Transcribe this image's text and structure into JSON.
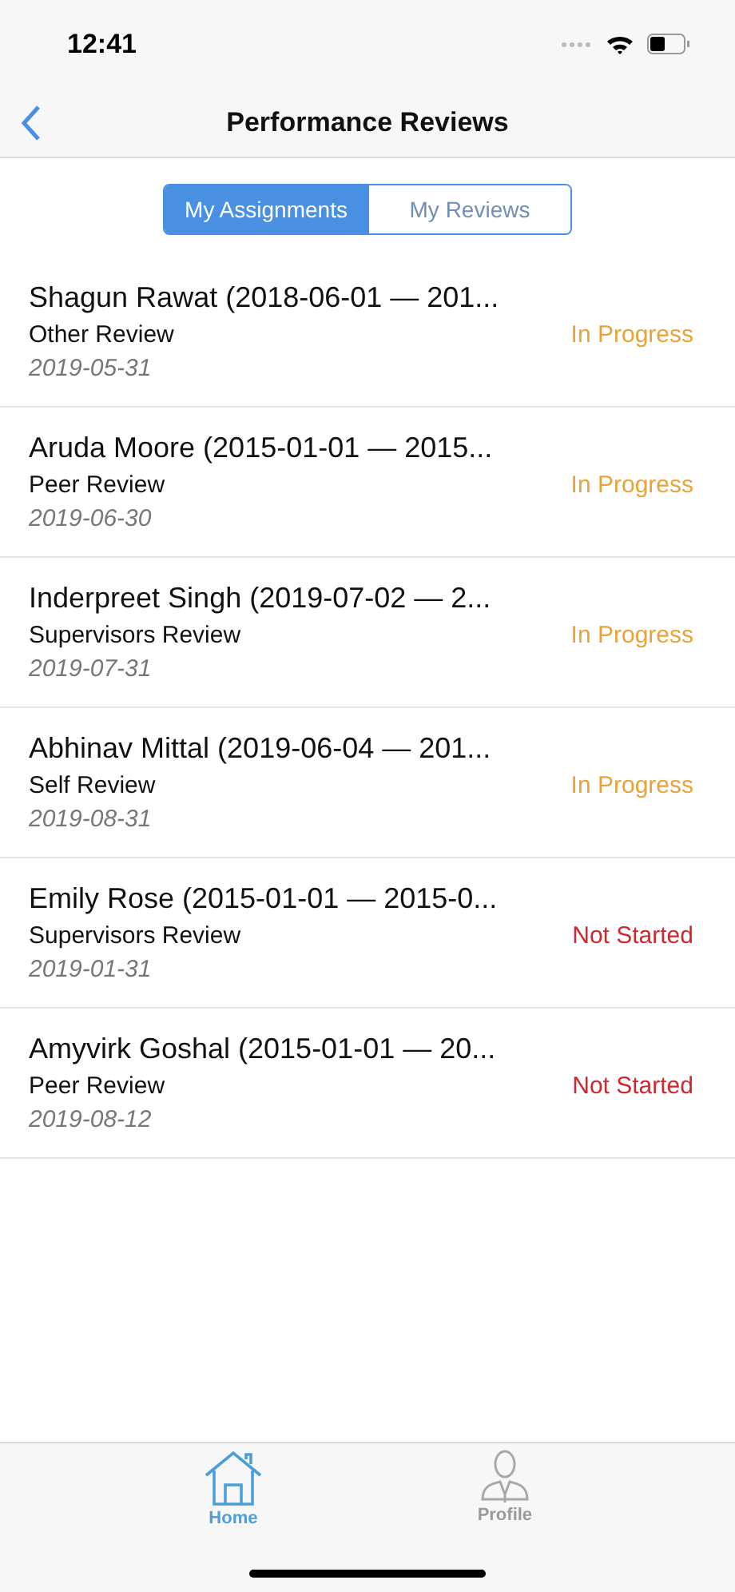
{
  "status_bar": {
    "time": "12:41"
  },
  "nav": {
    "title": "Performance Reviews"
  },
  "segments": [
    {
      "label": "My Assignments",
      "selected": true
    },
    {
      "label": "My Reviews",
      "selected": false
    }
  ],
  "reviews": [
    {
      "title": "Shagun Rawat (2018-06-01 — 201...",
      "type": "Other Review",
      "date": "2019-05-31",
      "status": "In Progress",
      "kind": "in_progress"
    },
    {
      "title": "Aruda Moore (2015-01-01 — 2015...",
      "type": "Peer Review",
      "date": "2019-06-30",
      "status": "In Progress",
      "kind": "in_progress"
    },
    {
      "title": "Inderpreet Singh (2019-07-02 — 2...",
      "type": "Supervisors Review",
      "date": "2019-07-31",
      "status": "In Progress",
      "kind": "in_progress"
    },
    {
      "title": "Abhinav Mittal (2019-06-04 — 201...",
      "type": "Self Review",
      "date": "2019-08-31",
      "status": "In Progress",
      "kind": "in_progress"
    },
    {
      "title": "Emily Rose (2015-01-01 — 2015-0...",
      "type": "Supervisors Review",
      "date": "2019-01-31",
      "status": "Not Started",
      "kind": "not_started"
    },
    {
      "title": "Amyvirk Goshal (2015-01-01 — 20...",
      "type": "Peer Review",
      "date": "2019-08-12",
      "status": "Not Started",
      "kind": "not_started"
    }
  ],
  "tab_bar": [
    {
      "label": "Home",
      "kind": "home",
      "selected": true
    },
    {
      "label": "Profile",
      "kind": "profile",
      "selected": false
    }
  ]
}
